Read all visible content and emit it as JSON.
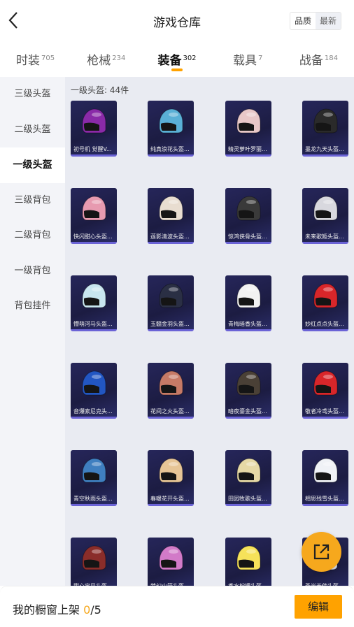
{
  "header": {
    "title": "游戏仓库",
    "sort_quality": "品质",
    "sort_newest": "最新"
  },
  "tabs": [
    {
      "label": "时装",
      "count": "705"
    },
    {
      "label": "枪械",
      "count": "234"
    },
    {
      "label": "装备",
      "count": "302",
      "active": true
    },
    {
      "label": "载具",
      "count": "7"
    },
    {
      "label": "战备",
      "count": "184"
    }
  ],
  "sidebar": [
    {
      "label": "三级头盔"
    },
    {
      "label": "二级头盔"
    },
    {
      "label": "一级头盔",
      "active": true
    },
    {
      "label": "三级背包"
    },
    {
      "label": "二级背包"
    },
    {
      "label": "一级背包"
    },
    {
      "label": "背包挂件"
    }
  ],
  "main": {
    "count_label": "一级头盔: 44件"
  },
  "items": [
    {
      "name": "初号机 觉醒V...",
      "color": "#8a2aa8"
    },
    {
      "name": "纯真浪花头盔...",
      "color": "#5ab0d6"
    },
    {
      "name": "精灵萝叶罗丽...",
      "color": "#e8c8c8"
    },
    {
      "name": "墨龙九天头盔...",
      "color": "#2a2a2a"
    },
    {
      "name": "快闪甜心头盔...",
      "color": "#e79ab0"
    },
    {
      "name": "莲影清波头盔...",
      "color": "#e8ddd0"
    },
    {
      "name": "惊鸿侠骨头盔...",
      "color": "#3a3a3a"
    },
    {
      "name": "未来歌姬头盔...",
      "color": "#d8d8de"
    },
    {
      "name": "懵萌河马头盔...",
      "color": "#c8e6ef"
    },
    {
      "name": "玉髓金羽头盔...",
      "color": "#2a2f44"
    },
    {
      "name": "青梅暗香头盔...",
      "color": "#f2f2f2"
    },
    {
      "name": "妙红点点头盔...",
      "color": "#d8262a"
    },
    {
      "name": "音爆索尼克头...",
      "color": "#2256c2"
    },
    {
      "name": "花间之火头盔...",
      "color": "#c67a66"
    },
    {
      "name": "暗夜鎏金头盔...",
      "color": "#4a4036"
    },
    {
      "name": "敬者冷鸢头盔...",
      "color": "#d8262a"
    },
    {
      "name": "青空秋雨头盔...",
      "color": "#3f7fc0"
    },
    {
      "name": "春暖花开头盔...",
      "color": "#e6c596"
    },
    {
      "name": "田园牧歌头盔...",
      "color": "#e6d9a6"
    },
    {
      "name": "相思残雪头盔...",
      "color": "#f0f2f6"
    },
    {
      "name": "甜心宝贝头盔...",
      "color": "#8a2d2a"
    },
    {
      "name": "梦幻火箭头盔...",
      "color": "#d27ac8"
    },
    {
      "name": "香水柠檬头盔...",
      "color": "#f6e25a"
    },
    {
      "name": "圣光天使头盔...",
      "color": "#e0e2f0"
    }
  ],
  "footer": {
    "label": "我的橱窗上架 ",
    "current": "0",
    "separator": "/",
    "total": "5",
    "edit_label": "编辑"
  },
  "colors": {
    "accent": "#ffa200",
    "card_bg": "#26265a",
    "card_border": "#6b63d6"
  }
}
